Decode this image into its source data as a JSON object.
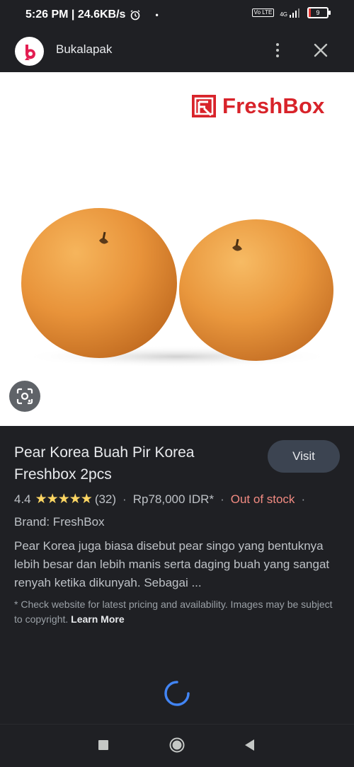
{
  "status_bar": {
    "time_speed": "5:26 PM | 24.6KB/s",
    "dot": "•",
    "volte": "Vo LTE",
    "network": "4G",
    "battery": "9"
  },
  "app_bar": {
    "title": "Bukalapak",
    "icons": [
      "bukalapak-logo",
      "more-vert-icon",
      "close-icon"
    ]
  },
  "hero": {
    "brand_logo_text": "FreshBox",
    "image_subject": "two Korean pears",
    "lens_icon": "google-lens-icon"
  },
  "product": {
    "title": "Pear Korea Buah Pir Korea Freshbox 2pcs",
    "visit_label": "Visit",
    "rating": "4.4",
    "stars": "★★★★★",
    "rating_value": 4.4,
    "reviews": "(32)",
    "sep": "·",
    "price": "Rp78,000 IDR*",
    "stock": "Out of stock",
    "brand": "Brand: FreshBox",
    "description": "Pear Korea juga biasa disebut pear singo yang bentuknya lebih besar dan lebih manis serta daging buah yang sangat renyah ketika dikunyah. Sebagai ...",
    "disclaimer": "* Check website for latest pricing and availability. Images may be subject to copyright.",
    "learn_more": "Learn More"
  },
  "colors": {
    "background": "#1f2024",
    "visit_button": "#3c4451",
    "stars": "#fdd663",
    "out_of_stock": "#f28b82",
    "brand_red": "#d8232a",
    "spinner": "#4285f4"
  },
  "nav_bar": {
    "icons": [
      "recents-square-icon",
      "home-circle-icon",
      "back-triangle-icon"
    ]
  }
}
